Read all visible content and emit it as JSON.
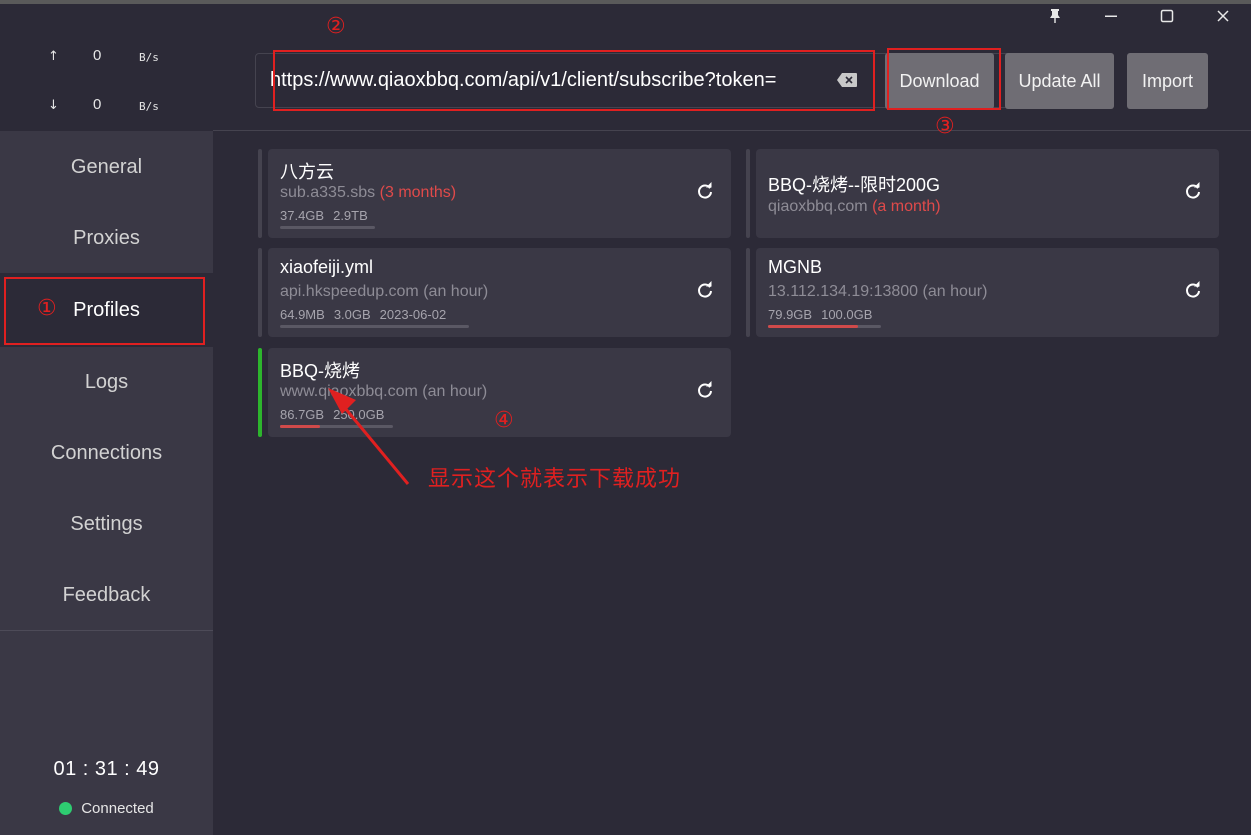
{
  "window": {
    "pin_icon": "pin-icon",
    "minimize_icon": "minimize-icon",
    "maximize_icon": "maximize-icon",
    "close_icon": "close-icon"
  },
  "traffic": {
    "up_arrow": "↑",
    "up_value": "0",
    "up_unit": "B/s",
    "down_arrow": "↓",
    "down_value": "0",
    "down_unit": "B/s"
  },
  "nav": {
    "items": [
      {
        "label": "General"
      },
      {
        "label": "Proxies"
      },
      {
        "label": "Profiles",
        "active": true
      },
      {
        "label": "Logs"
      },
      {
        "label": "Connections"
      },
      {
        "label": "Settings"
      },
      {
        "label": "Feedback"
      }
    ]
  },
  "status": {
    "time": "01 : 31 : 49",
    "connection_text": "Connected",
    "connection_color": "#2ecc71"
  },
  "toolbar": {
    "url_value": "https://www.qiaoxbbq.com/api/v1/client/subscribe?token=",
    "download_label": "Download",
    "update_all_label": "Update All",
    "import_label": "Import",
    "clear_icon": "backspace-icon"
  },
  "profiles": [
    {
      "name": "八方云",
      "host": "sub.a335.sbs",
      "age": "(3 months)",
      "age_expired": true,
      "used": "37.4GB",
      "total": "2.9TB",
      "expire": "",
      "usage_fraction": 0.0,
      "active": false
    },
    {
      "name": "BBQ-烧烤--限时200G",
      "host": "qiaoxbbq.com",
      "age": "(a month)",
      "age_expired": true,
      "used": "",
      "total": "",
      "expire": "",
      "usage_fraction": null,
      "active": false
    },
    {
      "name": "xiaofeiji.yml",
      "host": "api.hkspeedup.com",
      "age": "(an hour)",
      "age_expired": false,
      "used": "64.9MB",
      "total": "3.0GB",
      "expire": "2023-06-02",
      "usage_fraction": 0.0,
      "active": false
    },
    {
      "name": "MGNB",
      "host": "13.112.134.19:13800",
      "age": "(an hour)",
      "age_expired": false,
      "used": "79.9GB",
      "total": "100.0GB",
      "expire": "",
      "usage_fraction": 0.8,
      "active": false
    },
    {
      "name": "BBQ-烧烤",
      "host": "www.qiaoxbbq.com",
      "age": "(an hour)",
      "age_expired": false,
      "used": "86.7GB",
      "total": "250.0GB",
      "expire": "",
      "usage_fraction": 0.35,
      "active": true
    }
  ],
  "annotations": {
    "n1": "①",
    "n2": "②",
    "n3": "③",
    "n4": "④",
    "note": "显示这个就表示下载成功",
    "color": "#e02020"
  }
}
